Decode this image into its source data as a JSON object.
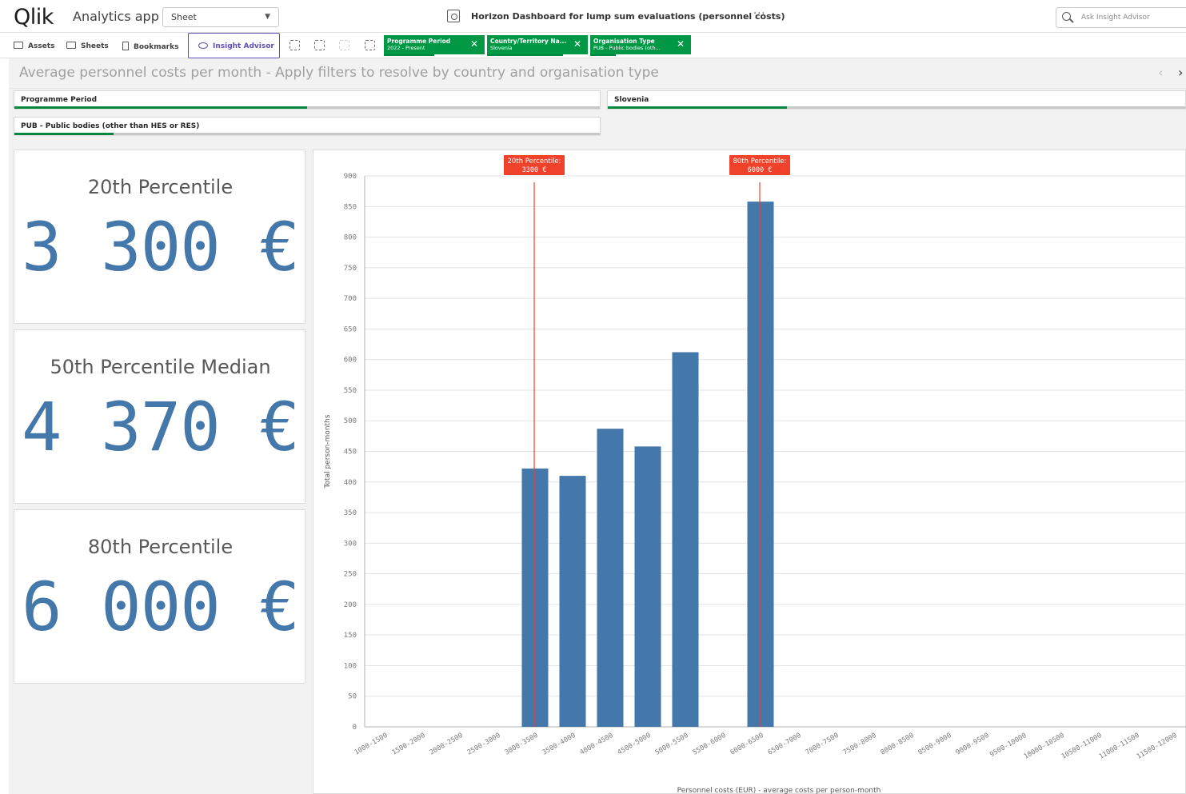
{
  "header": {
    "logo": "Qlik",
    "app_name": "Analytics app",
    "sheet_select": "Sheet",
    "dashboard_title": "Horizon Dashboard for lump sum evaluations (personnel costs)",
    "more_label": "···",
    "ask_placeholder": "Ask Insight Advisor"
  },
  "toolbar": {
    "assets_label": "Assets",
    "sheets_label": "Sheets",
    "bookmarks_label": "Bookmarks",
    "insight_label": "Insight Advisor",
    "selections": [
      {
        "name": "Programme Period",
        "value": "2022 - Present",
        "fill": 0.5
      },
      {
        "name": "Country/Territory Na...",
        "value": "Slovenia",
        "fill": 0.75
      },
      {
        "name": "Organisation Type",
        "value": "PUB - Public bodies (oth...",
        "fill": 0.25
      }
    ]
  },
  "page": {
    "title": "Average personnel costs per month - Apply filters to resolve by country and organisation type",
    "nav_prev": "‹",
    "nav_next": "›"
  },
  "filters": [
    {
      "label": "Programme Period",
      "fill": 0.5
    },
    {
      "label": "Slovenia",
      "fill": 0.31
    },
    {
      "label": "PUB - Public bodies (other than HES or RES)",
      "fill": 0.17
    }
  ],
  "kpis": [
    {
      "title": "20th Percentile",
      "value": "3 300 €"
    },
    {
      "title": "50th Percentile Median",
      "value": "4 370 €"
    },
    {
      "title": "80th Percentile",
      "value": "6 000 €"
    }
  ],
  "colors": {
    "qlik_green": "#009845",
    "bar_blue": "#4477aa",
    "reference_red": "#f0422a",
    "insight_purple": "#5e4fb8"
  },
  "chart_data": {
    "type": "bar",
    "xlabel": "Personnel costs (EUR) - average costs per person-month",
    "ylabel": "Total person-months",
    "ylim": [
      0,
      900
    ],
    "yticks": [
      0,
      50,
      100,
      150,
      200,
      250,
      300,
      350,
      400,
      450,
      500,
      550,
      600,
      650,
      700,
      750,
      800,
      850,
      900
    ],
    "categories": [
      "1000-1500",
      "1500-2000",
      "2000-2500",
      "2500-3000",
      "3000-3500",
      "3500-4000",
      "4000-4500",
      "4500-5000",
      "5000-5500",
      "5500-6000",
      "6000-6500",
      "6500-7000",
      "7000-7500",
      "7500-8000",
      "8000-8500",
      "8500-9000",
      "9000-9500",
      "9500-10000",
      "10000-10500",
      "10500-11000",
      "11000-11500",
      "11500-12000"
    ],
    "values": [
      0,
      0,
      0,
      0,
      422,
      410,
      487,
      458,
      612,
      0,
      858,
      0,
      0,
      0,
      0,
      0,
      0,
      0,
      0,
      0,
      0,
      0
    ],
    "grid": true,
    "reference_lines": [
      {
        "label": "20th Percentile:",
        "value_label": "3300 €",
        "category": "3000-3500"
      },
      {
        "label": "80th Percentile:",
        "value_label": "6000 €",
        "category": "6000-6500"
      }
    ]
  }
}
